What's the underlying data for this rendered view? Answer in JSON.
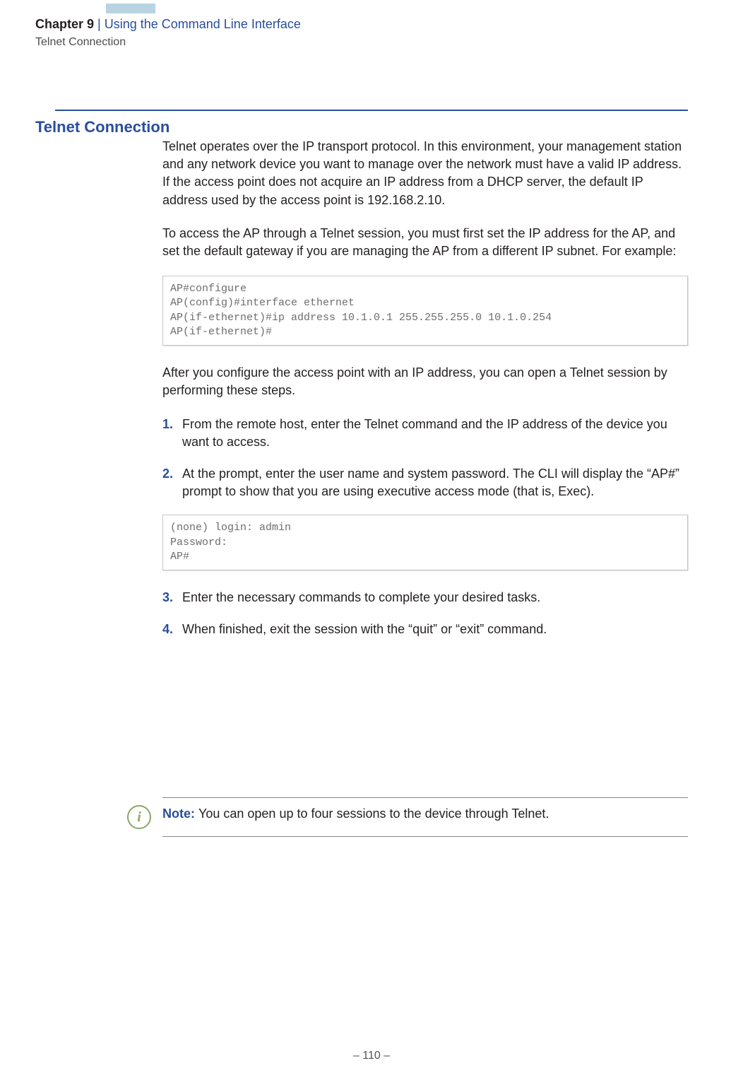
{
  "header": {
    "chapter_label": "Chapter 9",
    "separator": "  |  ",
    "chapter_title": "Using the Command Line Interface",
    "subtitle": "Telnet Connection"
  },
  "section_title": "Telnet Connection",
  "para1": "Telnet operates over the IP transport protocol. In this environment, your management station and any network device you want to manage over the network must have a valid IP address. If the access point does not acquire an IP address from a DHCP server, the default IP address used by the access point is 192.168.2.10.",
  "para2": "To access the AP through a Telnet session, you must first set the IP address for the AP, and set the default gateway if you are managing the AP from a different IP subnet. For example:",
  "code1": "AP#configure\nAP(config)#interface ethernet\nAP(if-ethernet)#ip address 10.1.0.1 255.255.255.0 10.1.0.254\nAP(if-ethernet)#",
  "para3": "After you configure the access point with an IP address, you can open a Telnet session by performing these steps.",
  "steps": {
    "n1": "1.",
    "t1": "From the remote host, enter the Telnet command and the IP address of the device you want to access.",
    "n2": "2.",
    "t2": "At the prompt, enter the user name and system password. The CLI will display the “AP#” prompt to show that you are using executive access mode (that is, Exec).",
    "n3": "3.",
    "t3": "Enter the necessary commands to complete your desired tasks.",
    "n4": "4.",
    "t4": "When finished, exit the session with the “quit” or “exit” command."
  },
  "code2": "(none) login: admin\nPassword:\nAP#",
  "note": {
    "label": "Note: ",
    "text": "You can open up to four sessions to the device through Telnet.",
    "icon_glyph": "i"
  },
  "footer": "–  110  –"
}
